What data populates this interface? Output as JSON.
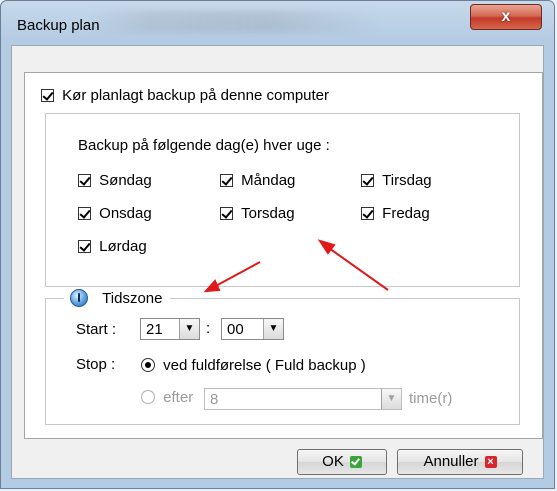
{
  "window": {
    "title": "Backup plan",
    "close_glyph": "x"
  },
  "main": {
    "run_scheduled_label": "Kør planlagt backup på denne computer",
    "days_heading": "Backup på følgende dag(e) hver uge :",
    "days": [
      {
        "label": "Søndag",
        "checked": true
      },
      {
        "label": "Måndag",
        "checked": true
      },
      {
        "label": "Tirsdag",
        "checked": true
      },
      {
        "label": "Onsdag",
        "checked": true
      },
      {
        "label": "Torsdag",
        "checked": true
      },
      {
        "label": "Fredag",
        "checked": true
      },
      {
        "label": "Lørdag",
        "checked": true
      }
    ],
    "timezone_label": "Tidszone",
    "start_label": "Start :",
    "start_hour": "21",
    "time_separator": ":",
    "start_minute": "00",
    "stop_label": "Stop :",
    "stop_option_1": "ved fuldførelse ( Fuld backup )",
    "stop_option_2": "efter",
    "after_value": "8",
    "after_unit": "time(r)"
  },
  "buttons": {
    "ok_label": "OK",
    "cancel_label": "Annuller"
  },
  "icons": {
    "close": "close-icon",
    "checkbox": "checkbox-checked-icon",
    "timezone": "globe-clock-icon",
    "dropdown": "chevron-down-icon",
    "ok": "green-check-icon",
    "cancel": "red-x-icon"
  },
  "colors": {
    "annotation_arrow": "#e01818",
    "ok_icon": "#3aa43a",
    "cancel_icon": "#d8262c"
  }
}
